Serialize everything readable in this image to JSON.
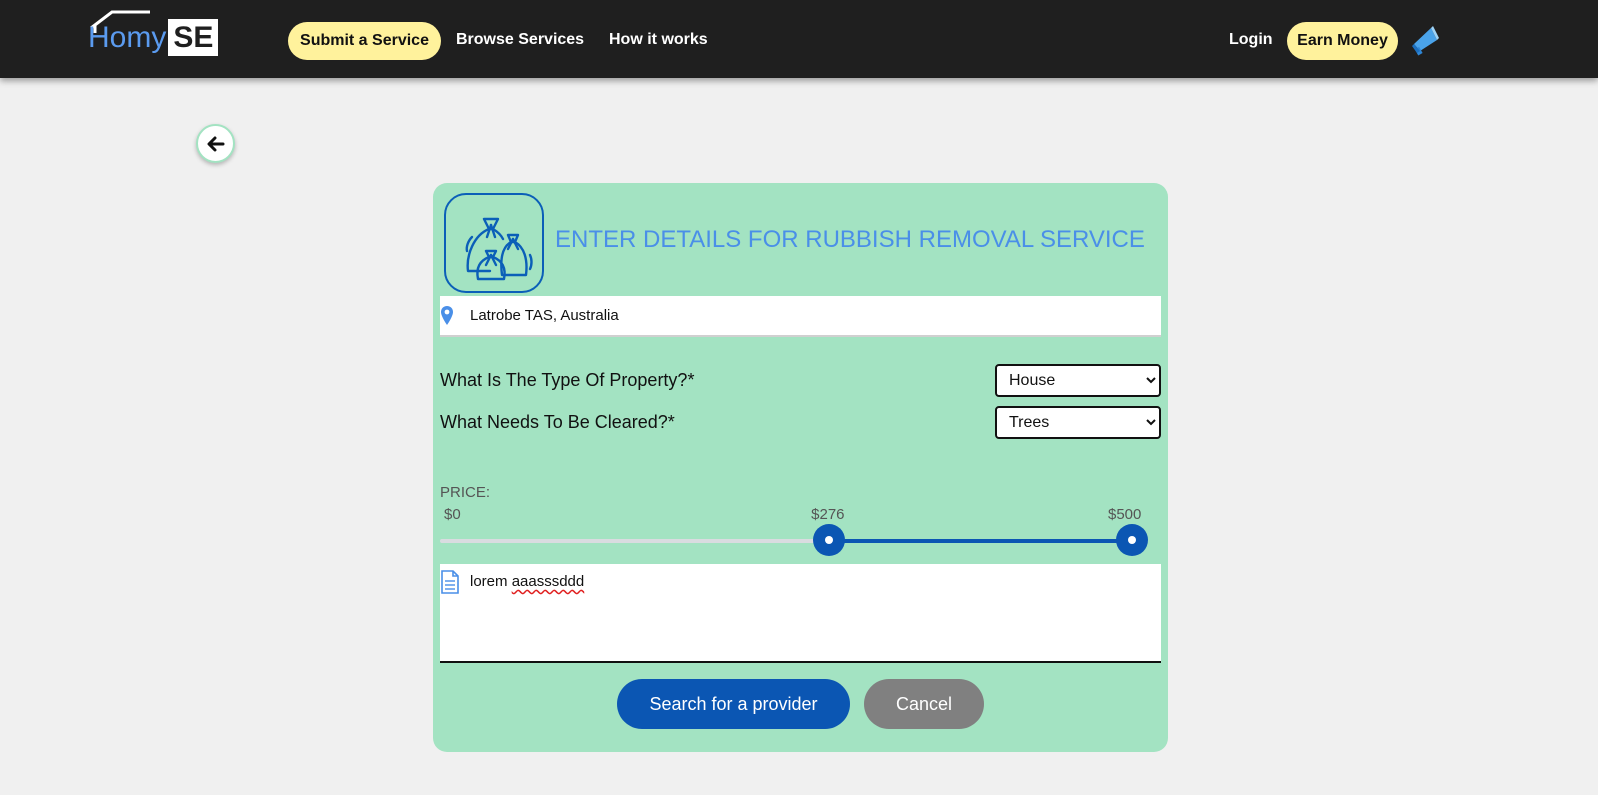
{
  "nav": {
    "logo": {
      "part1": "Homy",
      "part2": "SE"
    },
    "submit_service": "Submit a Service",
    "browse_services": "Browse Services",
    "how_it_works": "How it works",
    "login": "Login",
    "earn_money": "Earn Money",
    "icons": {
      "back": "arrow-left-icon",
      "megaphone": "megaphone-icon"
    }
  },
  "form": {
    "title": "ENTER DETAILS FOR RUBBISH REMOVAL SERVICE",
    "service_icon": "rubbish-bags-icon",
    "location": {
      "value": "Latrobe TAS, Australia",
      "icon": "location-pin-icon"
    },
    "property_type": {
      "label": "What Is The Type Of Property?*",
      "selected": "House"
    },
    "clear_item": {
      "label": "What Needs To Be Cleared?*",
      "selected": "Trees"
    },
    "price": {
      "label": "PRICE:",
      "min_label": "$0",
      "low_label": "$276",
      "high_label": "$500",
      "min": 0,
      "max": 500,
      "low": 276,
      "high": 500
    },
    "notes": {
      "word1": "lorem",
      "word2": "aaasssddd",
      "icon": "document-icon"
    },
    "search_button": "Search for a provider",
    "cancel_button": "Cancel"
  },
  "colors": {
    "navbar": "#1f1f1f",
    "pill": "#fff29c",
    "card": "#a3e3c2",
    "title": "#4a8fe8",
    "primary": "#0b56b3",
    "cancel": "#808080"
  }
}
